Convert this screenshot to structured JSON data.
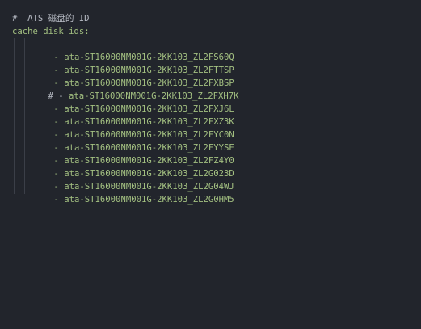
{
  "editor": {
    "comment_line": "#  ATS 磁盘的 ID",
    "key_line": "cache_disk_ids:",
    "lines": [
      {
        "prefix": "- ",
        "value": "ata-ST16000NM001G-2KK103_ZL2FS60Q",
        "commented": false
      },
      {
        "prefix": "- ",
        "value": "ata-ST16000NM001G-2KK103_ZL2FTTSP",
        "commented": false
      },
      {
        "prefix": "- ",
        "value": "ata-ST16000NM001G-2KK103_ZL2FXBSP",
        "commented": false
      },
      {
        "prefix": "# - ",
        "value": "ata-ST16000NM001G-2KK103_ZL2FXH7K",
        "commented": true
      },
      {
        "prefix": "- ",
        "value": "ata-ST16000NM001G-2KK103_ZL2FXJ6L",
        "commented": false
      },
      {
        "prefix": "- ",
        "value": "ata-ST16000NM001G-2KK103_ZL2FXZ3K",
        "commented": false
      },
      {
        "prefix": "- ",
        "value": "ata-ST16000NM001G-2KK103_ZL2FYC0N",
        "commented": false
      },
      {
        "prefix": "- ",
        "value": "ata-ST16000NM001G-2KK103_ZL2FYYSE",
        "commented": false
      },
      {
        "prefix": "- ",
        "value": "ata-ST16000NM001G-2KK103_ZL2FZ4Y0",
        "commented": false
      },
      {
        "prefix": "- ",
        "value": "ata-ST16000NM001G-2KK103_ZL2G023D",
        "commented": false
      },
      {
        "prefix": "- ",
        "value": "ata-ST16000NM001G-2KK103_ZL2G04WJ",
        "commented": false
      },
      {
        "prefix": "- ",
        "value": "ata-ST16000NM001G-2KK103_ZL2G0HM5",
        "commented": false
      }
    ]
  },
  "colors": {
    "background": "#22252c",
    "comment": "#b6bac3",
    "string": "#a3c081",
    "indent_guide": "#3b3f48"
  }
}
